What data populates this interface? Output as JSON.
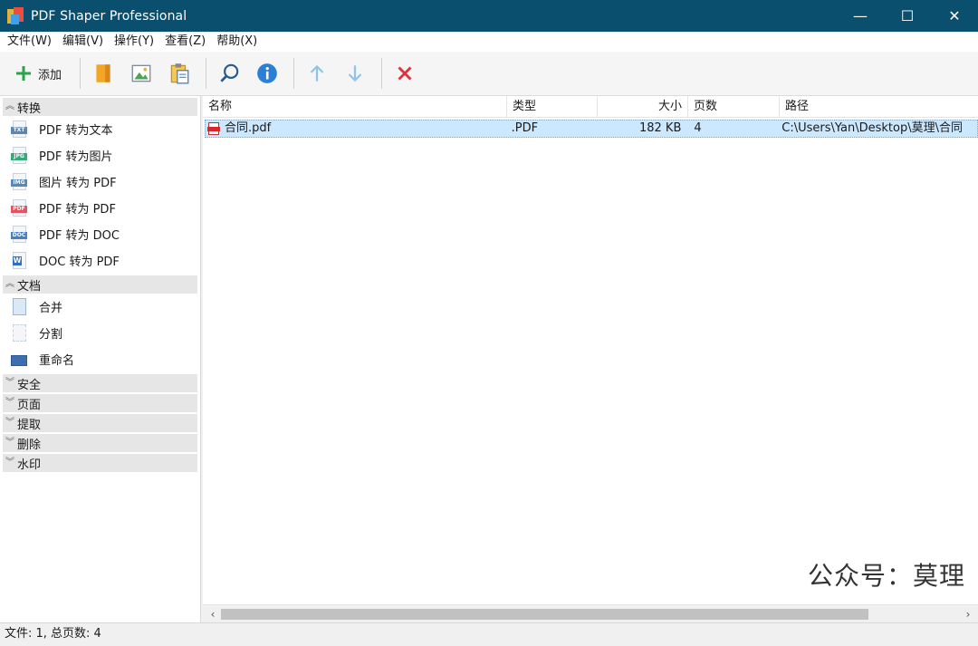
{
  "window": {
    "title": "PDF Shaper Professional",
    "minimize": "—",
    "maximize": "☐",
    "close": "✕"
  },
  "menu": [
    "文件(W)",
    "编辑(V)",
    "操作(Y)",
    "查看(Z)",
    "帮助(X)"
  ],
  "toolbar": {
    "add_label": "添加"
  },
  "sidebar": {
    "groups": [
      {
        "label": "转换",
        "expanded": true,
        "items": [
          {
            "label": "PDF 转为文本",
            "tag": "TXT",
            "color": "#5b87b5"
          },
          {
            "label": "PDF 转为图片",
            "tag": "JPG",
            "color": "#36a97a"
          },
          {
            "label": "图片 转为 PDF",
            "tag": "IMG",
            "color": "#5b87b5"
          },
          {
            "label": "PDF 转为 PDF",
            "tag": "PDF",
            "color": "#e0555f"
          },
          {
            "label": "PDF 转为 DOC",
            "tag": "DOC",
            "color": "#4b7fc0"
          },
          {
            "label": "DOC 转为 PDF",
            "tag": "W",
            "color": "#2e6fc4"
          }
        ]
      },
      {
        "label": "文档",
        "expanded": true,
        "items": [
          {
            "label": "合并"
          },
          {
            "label": "分割"
          },
          {
            "label": "重命名"
          }
        ]
      },
      {
        "label": "安全",
        "expanded": false
      },
      {
        "label": "页面",
        "expanded": false
      },
      {
        "label": "提取",
        "expanded": false
      },
      {
        "label": "删除",
        "expanded": false
      },
      {
        "label": "水印",
        "expanded": false
      }
    ]
  },
  "filelist": {
    "columns": [
      "名称",
      "类型",
      "大小",
      "页数",
      "路径"
    ],
    "rows": [
      {
        "name": "合同.pdf",
        "type": ".PDF",
        "size": "182 KB",
        "pages": "4",
        "path": "C:\\Users\\Yan\\Desktop\\莫理\\合同"
      }
    ]
  },
  "watermark": "公众号：莫理",
  "status": "文件: 1, 总页数: 4",
  "colors": {
    "titlebar": "#0b4f6e",
    "selection": "#cce8ff",
    "delete_red": "#e0303a",
    "arrow_blue": "#8ec4ea"
  }
}
